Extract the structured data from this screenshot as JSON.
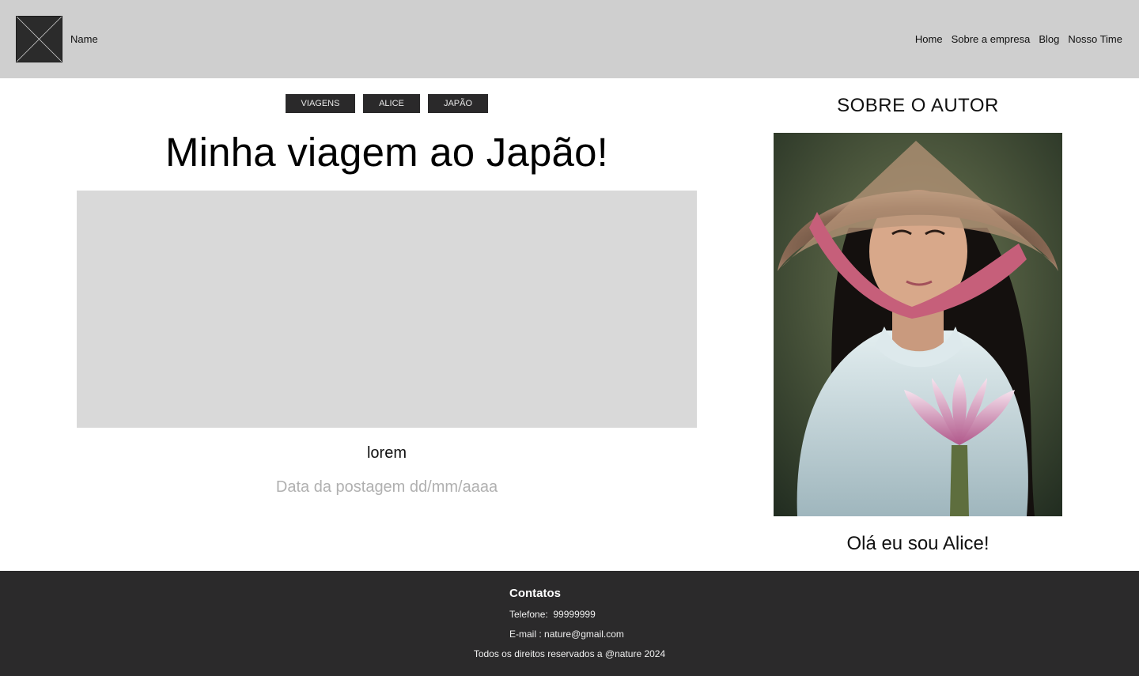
{
  "header": {
    "brand_name": "Name",
    "logo_icon": "image-placeholder-icon",
    "nav": [
      "Home",
      "Sobre a empresa",
      "Blog",
      "Nosso Time"
    ]
  },
  "article": {
    "tags": [
      "VIAGENS",
      "ALICE",
      "JAPÃO"
    ],
    "title": "Minha viagem ao Japão!",
    "caption": "lorem",
    "date": "Data da postagem dd/mm/aaaa"
  },
  "sidebar": {
    "heading": "SOBRE O AUTOR",
    "greeting": "Olá eu sou Alice!"
  },
  "footer": {
    "heading": "Contatos",
    "phone_label": "Telefone:",
    "phone_value": "99999999",
    "email_label": "E-mail :",
    "email_value": "nature@gmail.com",
    "rights": "Todos os direitos reservados a @nature 2024"
  },
  "colors": {
    "header_bg": "#cfcfcf",
    "tag_bg": "#2a292a",
    "image_placeholder": "#d9d9d9",
    "footer_bg": "#2b2a2b",
    "date_text": "#b0b0b0"
  }
}
